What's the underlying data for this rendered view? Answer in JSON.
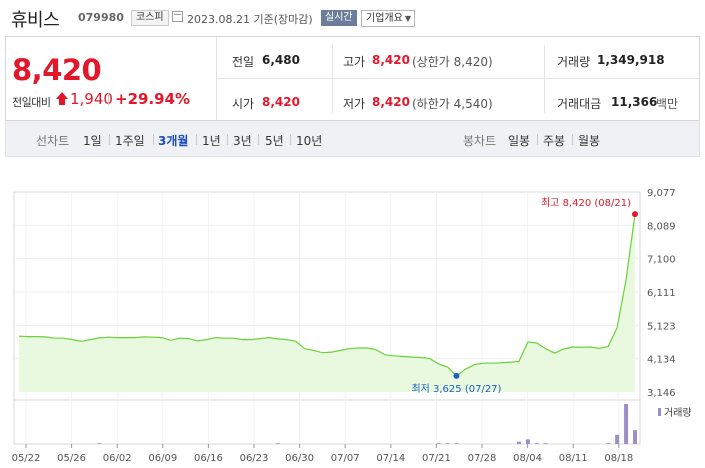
{
  "header": {
    "name": "휴비스",
    "code": "079980",
    "market": "코스피",
    "date": "2023.08.21 기준(장마감)",
    "realtime": "실시간",
    "overview": "기업개요"
  },
  "summary": {
    "price": "8,420",
    "change_label": "전일대비",
    "change_value": "1,940",
    "change_pct": "+29.94%",
    "prev_close_label": "전일",
    "prev_close": "6,480",
    "high_label": "고가",
    "high": "8,420",
    "high_limit": "(상한가 8,420)",
    "volume_label": "거래량",
    "volume": "1,349,918",
    "open_label": "시가",
    "open": "8,420",
    "low_label": "저가",
    "low": "8,420",
    "low_limit": "(하한가 4,540)",
    "turnover_label": "거래대금",
    "turnover": "11,366",
    "turnover_unit": "백만"
  },
  "nav": {
    "line_label": "선차트",
    "periods": [
      "1일",
      "1주일",
      "3개월",
      "1년",
      "3년",
      "5년",
      "10년"
    ],
    "active_period": "3개월",
    "candle_label": "봉차트",
    "candles": [
      "일봉",
      "주봉",
      "월봉"
    ]
  },
  "colors": {
    "up": "#e4162a",
    "line": "#6ad13a",
    "fill": "#e9f9df",
    "volume": "#9b8ec9",
    "low_marker": "#1f5fbf",
    "active_tab": "#1d4dba"
  },
  "chart_data": {
    "type": "area",
    "x_labels": [
      "05/22",
      "05/26",
      "06/02",
      "06/09",
      "06/16",
      "06/23",
      "06/30",
      "07/07",
      "07/14",
      "07/21",
      "07/28",
      "08/04",
      "08/11",
      "08/18"
    ],
    "y_ticks": [
      "9,077",
      "8,089",
      "7,100",
      "6,111",
      "5,123",
      "4,134",
      "3,146"
    ],
    "ylim": [
      3146,
      9077
    ],
    "prices": [
      4800,
      4790,
      4790,
      4780,
      4740,
      4740,
      4700,
      4650,
      4700,
      4750,
      4770,
      4760,
      4760,
      4760,
      4780,
      4770,
      4760,
      4680,
      4740,
      4730,
      4660,
      4700,
      4760,
      4740,
      4740,
      4700,
      4700,
      4730,
      4760,
      4720,
      4700,
      4650,
      4430,
      4380,
      4310,
      4330,
      4380,
      4430,
      4450,
      4450,
      4400,
      4250,
      4220,
      4200,
      4180,
      4170,
      4140,
      3980,
      3890,
      3625,
      3820,
      3960,
      4000,
      4000,
      4010,
      4030,
      4050,
      4630,
      4600,
      4430,
      4300,
      4420,
      4480,
      4470,
      4480,
      4440,
      4500,
      5050,
      6480,
      8420
    ],
    "volumes": [
      0,
      0,
      0,
      0,
      0,
      0,
      0,
      0,
      0,
      1,
      0,
      0,
      0,
      0,
      0,
      0,
      0,
      0,
      0,
      0,
      0,
      0,
      0,
      0,
      0,
      0,
      0,
      0,
      0,
      1,
      0,
      0,
      0,
      0,
      0,
      0,
      0,
      0,
      0,
      0,
      0,
      0,
      0,
      0,
      0,
      0,
      0,
      1,
      1,
      1,
      0,
      0,
      0,
      0,
      0,
      0,
      3,
      6,
      1,
      1,
      0,
      0,
      0,
      0,
      0,
      0,
      1,
      12,
      52,
      18
    ],
    "volume_label": "거래량",
    "max_label": "최고 8,420 (08/21)",
    "min_label": "최저 3,625 (07/27)",
    "grid": true
  }
}
